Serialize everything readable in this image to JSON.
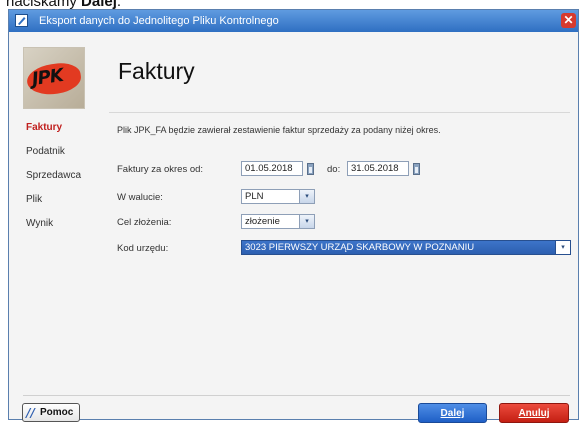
{
  "caption": {
    "prefix": "naciskamy ",
    "bold": "Dalej",
    "suffix": "."
  },
  "window": {
    "title": "Eksport danych do Jednolitego Pliku Kontrolnego",
    "close_icon": "close-icon",
    "app_icon": "edit-icon"
  },
  "logo": {
    "text": "JPK"
  },
  "page": {
    "title": "Faktury"
  },
  "nav": {
    "items": [
      {
        "label": "Faktury",
        "active": true
      },
      {
        "label": "Podatnik",
        "active": false
      },
      {
        "label": "Sprzedawca",
        "active": false
      },
      {
        "label": "Plik",
        "active": false
      },
      {
        "label": "Wynik",
        "active": false
      }
    ]
  },
  "form": {
    "description": "Plik JPK_FA będzie zawierał zestawienie faktur sprzedaży za podany niżej okres.",
    "period_label": "Faktury za okres od:",
    "date_from": "01.05.2018",
    "to_label": "do:",
    "date_to": "31.05.2018",
    "currency_label": "W walucie:",
    "currency": "PLN",
    "purpose_label": "Cel złożenia:",
    "purpose": "złożenie",
    "office_label": "Kod urzędu:",
    "office": "3023 PIERWSZY URZĄD SKARBOWY W POZNANIU",
    "dropdown_arrow": "▾"
  },
  "buttons": {
    "help": "Pomoc",
    "next": "Dalej",
    "cancel": "Anuluj"
  },
  "colors": {
    "accent_red": "#c0201f",
    "title_bar": "#3b7bd0",
    "next_button": "#2f6fd3",
    "cancel_button": "#d8311f"
  }
}
